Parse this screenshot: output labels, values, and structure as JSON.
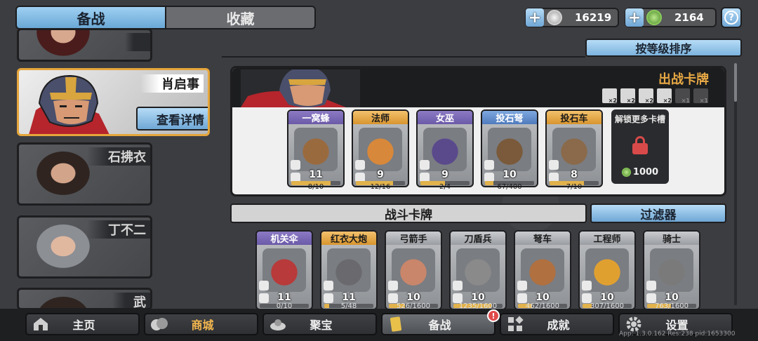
{
  "top_tabs": [
    {
      "label": "备战"
    },
    {
      "label": "收藏"
    }
  ],
  "currencies": [
    {
      "icon": "silver-coin-icon",
      "value": "16219"
    },
    {
      "icon": "green-gem-icon",
      "value": "2164"
    }
  ],
  "help": {
    "label": "?"
  },
  "sort_button": {
    "label": "按等级排序"
  },
  "heroes": [
    {
      "name": ""
    },
    {
      "name": "肖启事",
      "detail_label": "查看详情"
    },
    {
      "name": "石拂衣"
    },
    {
      "name": "丁不二"
    },
    {
      "name": "武"
    }
  ],
  "deck": {
    "title": "出战卡牌",
    "effect_multipliers": [
      "×2",
      "×2",
      "×2",
      "×2",
      "×1",
      "×1"
    ],
    "cards": [
      {
        "name": "一窝蜂",
        "level": "11",
        "progress": "8/10",
        "fill": 0.8,
        "rarity": "purple"
      },
      {
        "name": "法师",
        "level": "9",
        "progress": "12/16",
        "fill": 0.75,
        "rarity": "gold"
      },
      {
        "name": "女巫",
        "level": "9",
        "progress": "2/4",
        "fill": 0.5,
        "rarity": "purple"
      },
      {
        "name": "投石弩",
        "level": "10",
        "progress": "67/400",
        "fill": 0.17,
        "rarity": "blue"
      },
      {
        "name": "投石车",
        "level": "8",
        "progress": "7/10",
        "fill": 0.7,
        "rarity": "gold"
      }
    ],
    "locked_slot": {
      "title": "解锁更多卡槽",
      "cost": "1000"
    }
  },
  "battle_section": {
    "title": "战斗卡牌",
    "filter_label": "过滤器",
    "cards": [
      {
        "name": "机关伞",
        "level": "11",
        "progress": "0/10",
        "fill": 0.0,
        "rarity": "purple"
      },
      {
        "name": "红衣大炮",
        "level": "11",
        "progress": "5/48",
        "fill": 0.1,
        "rarity": "gold"
      },
      {
        "name": "弓箭手",
        "level": "10",
        "progress": "526/1600",
        "fill": 0.33,
        "rarity": "gray"
      },
      {
        "name": "刀盾兵",
        "level": "10",
        "progress": "1235/1600",
        "fill": 0.77,
        "rarity": "gray"
      },
      {
        "name": "弩车",
        "level": "10",
        "progress": "462/1600",
        "fill": 0.29,
        "rarity": "gray"
      },
      {
        "name": "工程师",
        "level": "10",
        "progress": "307/1600",
        "fill": 0.19,
        "rarity": "gray"
      },
      {
        "name": "骑士",
        "level": "10",
        "progress": "763/1600",
        "fill": 0.48,
        "rarity": "gray"
      }
    ]
  },
  "nav": [
    {
      "label": "主页",
      "icon": "home-icon"
    },
    {
      "label": "商城",
      "icon": "shop-icon"
    },
    {
      "label": "聚宝",
      "icon": "treasure-icon"
    },
    {
      "label": "备战",
      "icon": "cards-icon",
      "badge": "!"
    },
    {
      "label": "成就",
      "icon": "achievement-icon"
    },
    {
      "label": "设置",
      "icon": "gear-icon"
    }
  ],
  "version": "App: 1.3.0.162 Res:238 pid:1653300"
}
